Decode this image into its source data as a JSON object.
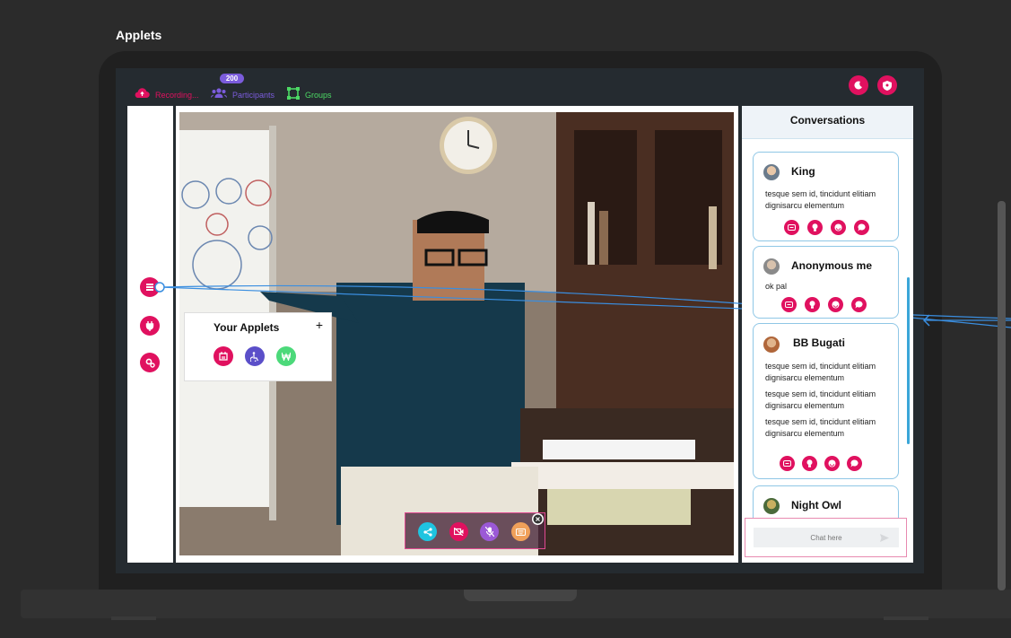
{
  "page": {
    "title": "Applets"
  },
  "topbar": {
    "recording_label": "Recording...",
    "participants_label": "Participants",
    "participants_count": "200",
    "groups_label": "Groups"
  },
  "colors": {
    "accent": "#e0115f",
    "recording": "#e0115f",
    "participants": "#7b5cdc",
    "groups": "#4cd964",
    "card_border": "#8fc7e6"
  },
  "header_icons": [
    "moon-icon",
    "shield-icon"
  ],
  "sidebar": {
    "items": [
      "layers-icon",
      "plug-icon",
      "settings-icon"
    ]
  },
  "applets_popup": {
    "title": "Your Applets",
    "add": "+",
    "items": [
      "calendar-icon",
      "accessibility-icon",
      "money-icon"
    ]
  },
  "controls": [
    "share-icon",
    "video-off-icon",
    "mic-off-icon",
    "keyboard-icon"
  ],
  "conversations": {
    "title": "Conversations",
    "cards": [
      {
        "name": "King",
        "messages": [
          "tesque sem id, tincidunt elitiam dignisarcu elementum"
        ]
      },
      {
        "name": "Anonymous me",
        "messages": [
          "ok pal"
        ]
      },
      {
        "name": "BB Bugati",
        "messages": [
          "tesque sem id, tincidunt elitiam dignisarcu elementum",
          "tesque sem id, tincidunt elitiam dignisarcu elementum",
          "tesque sem id, tincidunt elitiam dignisarcu elementum"
        ]
      },
      {
        "name": "Night Owl",
        "messages": []
      }
    ],
    "chat_placeholder": "Chat here"
  }
}
